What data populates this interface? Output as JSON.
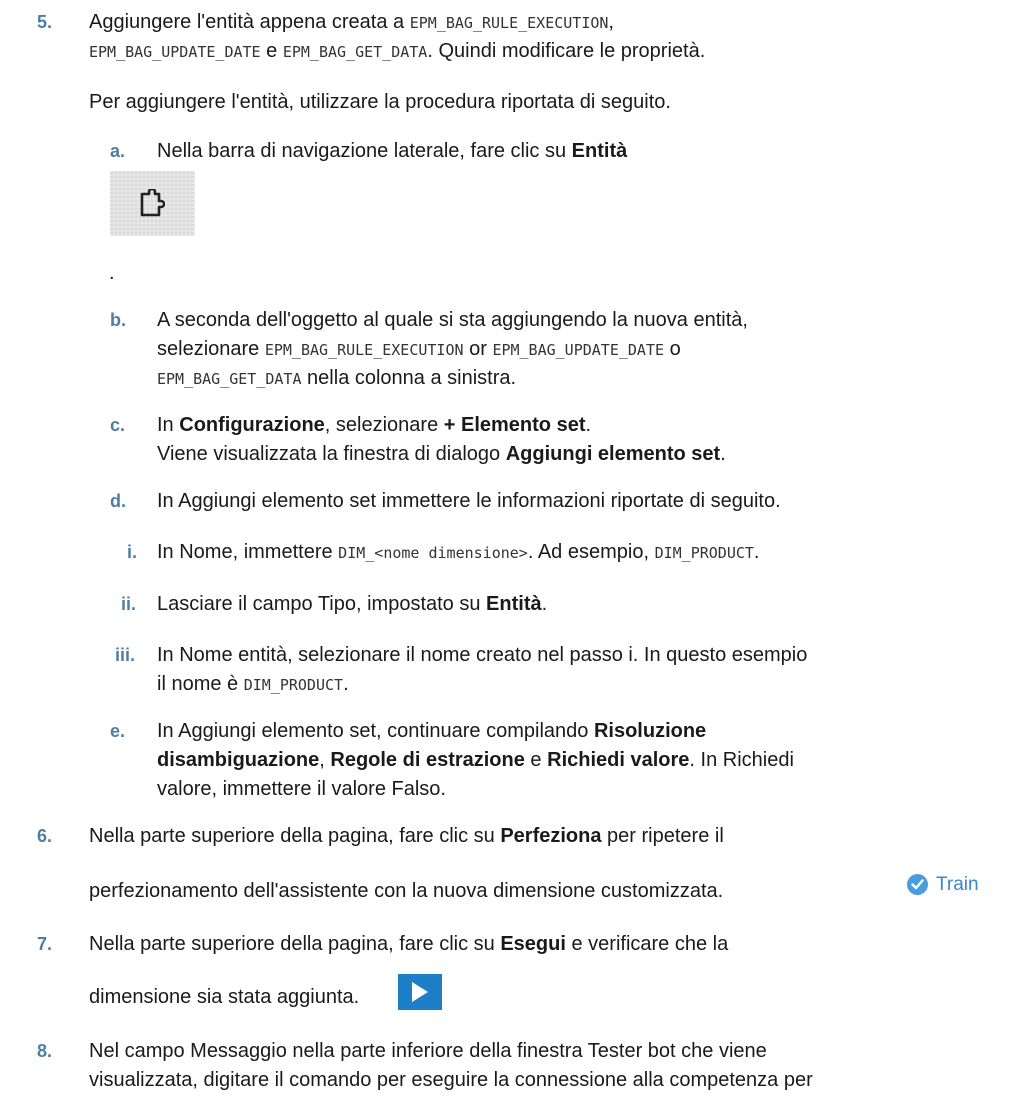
{
  "steps": {
    "s5": {
      "num": "5.",
      "line1_a": "Aggiungere l'entità appena creata a ",
      "line1_code": "EPM_BAG_RULE_EXECUTION",
      "line1_b": ",",
      "line2_code1": "EPM_BAG_UPDATE_DATE",
      "line2_a": " e ",
      "line2_code2": "EPM_BAG_GET_DATA",
      "line2_b": ". Quindi modificare le proprietà.",
      "intro": "Per aggiungere l'entità, utilizzare la procedura riportata di seguito.",
      "a": {
        "num": "a.",
        "text": "Nella barra di navigazione laterale, fare clic su ",
        "bold": "Entità",
        "icon": "puzzle-piece-icon",
        "after": "."
      },
      "b": {
        "num": "b.",
        "line1": "A seconda dell'oggetto al quale si sta aggiungendo la nuova entità,",
        "line2_a": "selezionare ",
        "line2_code1": "EPM_BAG_RULE_EXECUTION",
        "line2_b": " or ",
        "line2_code2": "EPM_BAG_UPDATE_DATE",
        "line2_c": " o",
        "line3_code": "EPM_BAG_GET_DATA",
        "line3_a": " nella colonna a sinistra."
      },
      "c": {
        "num": "c.",
        "l1_a": "In ",
        "l1_b1": "Configurazione",
        "l1_c": ", selezionare ",
        "l1_b2": "+ Elemento set",
        "l1_d": ".",
        "l2_a": "Viene visualizzata la finestra di dialogo ",
        "l2_b": "Aggiungi elemento set",
        "l2_c": "."
      },
      "d": {
        "num": "d.",
        "text": "In Aggiungi elemento set immettere le informazioni riportate di seguito.",
        "i": {
          "num": "i.",
          "a": "In Nome, immettere ",
          "code1": "DIM_<nome dimensione>",
          "b": ". Ad esempio, ",
          "code2": "DIM_PRODUCT",
          "c": "."
        },
        "ii": {
          "num": "ii.",
          "a": "Lasciare il campo Tipo, impostato su ",
          "bold": "Entità",
          "c": "."
        },
        "iii": {
          "num": "iii.",
          "line1": "In Nome entità, selezionare il nome creato nel passo i. In questo esempio",
          "line2_a": "il nome è ",
          "code": "DIM_PRODUCT",
          "line2_b": "."
        }
      },
      "e": {
        "num": "e.",
        "l1_a": "In Aggiungi elemento set, continuare compilando ",
        "l1_b": "Risoluzione",
        "l2_b1": "disambiguazione",
        "l2_a": ", ",
        "l2_b2": "Regole di estrazione",
        "l2_c": " e ",
        "l2_b3": "Richiedi valore",
        "l2_d": ". In Richiedi",
        "l3": "valore, immettere il valore Falso."
      }
    },
    "s6": {
      "num": "6.",
      "l1_a": "Nella parte superiore della pagina, fare clic su ",
      "l1_b": "Perfeziona",
      "l1_c": " per ripetere il",
      "l2": "perfezionamento dell'assistente con la nuova dimensione customizzata.",
      "button_label": "Train",
      "button_icon": "check-circle-icon"
    },
    "s7": {
      "num": "7.",
      "l1_a": "Nella parte superiore della pagina, fare clic su ",
      "l1_b": "Esegui",
      "l1_c": " e verificare che la",
      "l2": "dimensione sia stata aggiunta.",
      "button_icon": "play-icon"
    },
    "s8": {
      "num": "8.",
      "l1": "Nel campo Messaggio nella parte inferiore della finestra Tester bot che viene",
      "l2": "visualizzata, digitare il comando per eseguire la connessione alla competenza per"
    }
  },
  "colors": {
    "step_number": "#4f7ea3",
    "train_button_text": "#3a86c8",
    "play_button_bg": "#1d7fc8"
  }
}
